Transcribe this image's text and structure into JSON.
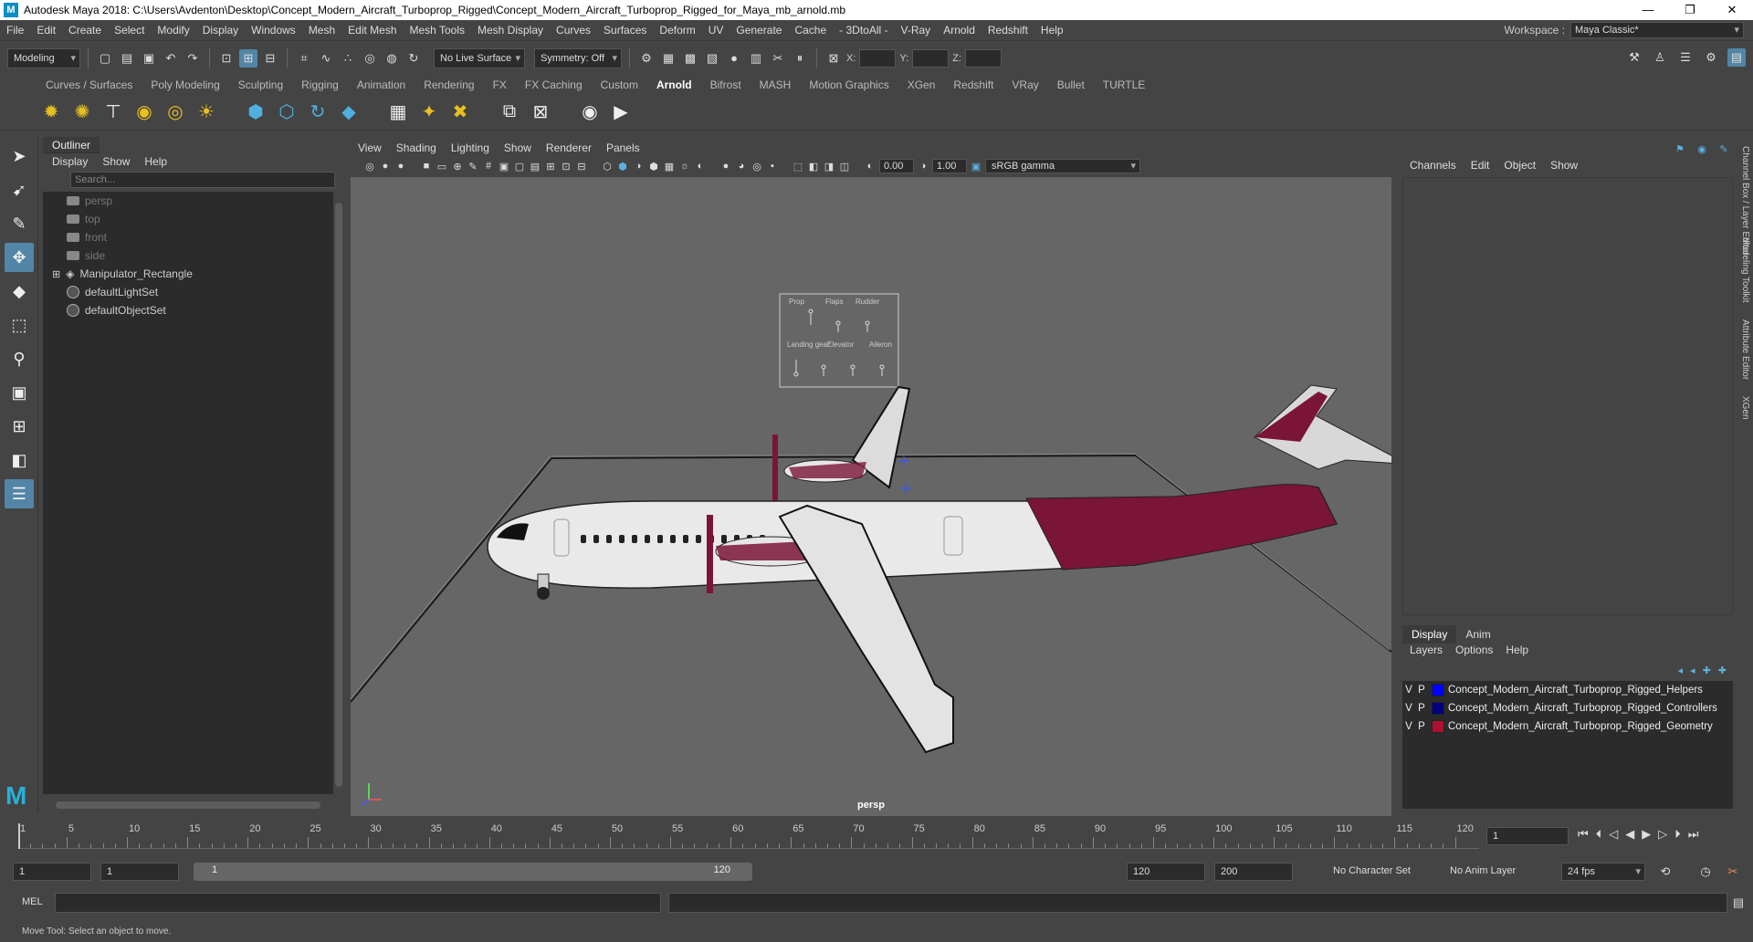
{
  "title": "Autodesk Maya 2018: C:\\Users\\Avdenton\\Desktop\\Concept_Modern_Aircraft_Turboprop_Rigged\\Concept_Modern_Aircraft_Turboprop_Rigged_for_Maya_mb_arnold.mb",
  "window_buttons": {
    "minimize": "—",
    "maximize": "❐",
    "close": "✕"
  },
  "menus": [
    "File",
    "Edit",
    "Create",
    "Select",
    "Modify",
    "Display",
    "Windows",
    "Mesh",
    "Edit Mesh",
    "Mesh Tools",
    "Mesh Display",
    "Curves",
    "Surfaces",
    "Deform",
    "UV",
    "Generate",
    "Cache",
    "- 3DtoAll -",
    "V-Ray",
    "Arnold",
    "Redshift",
    "Help"
  ],
  "workspace": {
    "label": "Workspace :",
    "value": "Maya Classic*"
  },
  "status_line": {
    "mode": "Modeling",
    "live_surface": "No Live Surface",
    "symmetry": "Symmetry: Off",
    "x_label": "X:",
    "y_label": "Y:",
    "z_label": "Z:"
  },
  "shelf_tabs": [
    "Curves / Surfaces",
    "Poly Modeling",
    "Sculpting",
    "Rigging",
    "Animation",
    "Rendering",
    "FX",
    "FX Caching",
    "Custom",
    "Arnold",
    "Bifrost",
    "MASH",
    "Motion Graphics",
    "XGen",
    "Redshift",
    "VRay",
    "Bullet",
    "TURTLE"
  ],
  "shelf_active": "Arnold",
  "outliner": {
    "title": "Outliner",
    "menus": [
      "Display",
      "Show",
      "Help"
    ],
    "search_placeholder": "Search...",
    "items": [
      {
        "label": "persp",
        "type": "camera",
        "dim": true
      },
      {
        "label": "top",
        "type": "camera",
        "dim": true
      },
      {
        "label": "front",
        "type": "camera",
        "dim": true
      },
      {
        "label": "side",
        "type": "camera",
        "dim": true
      },
      {
        "label": "Manipulator_Rectangle",
        "type": "group",
        "dim": false
      },
      {
        "label": "defaultLightSet",
        "type": "set",
        "dim": false
      },
      {
        "label": "defaultObjectSet",
        "type": "set",
        "dim": false
      }
    ]
  },
  "viewport": {
    "menus": [
      "View",
      "Shading",
      "Lighting",
      "Show",
      "Renderer",
      "Panels"
    ],
    "exposure": "0.00",
    "gamma": "1.00",
    "color_space": "sRGB gamma",
    "camera_label": "persp",
    "hud_labels": {
      "row1": [
        "Prop",
        "Flaps",
        "Rudder"
      ],
      "row2": [
        "Landing gear",
        "Elevator",
        "Aileron"
      ]
    },
    "fuselage_color": "#e9e9e9",
    "livery_color": "#7a1538"
  },
  "channel_box": {
    "menus": [
      "Channels",
      "Edit",
      "Object",
      "Show"
    ],
    "layer_tabs": [
      "Display",
      "Anim"
    ],
    "layer_menus": [
      "Layers",
      "Options",
      "Help"
    ],
    "layers": [
      {
        "v": "V",
        "p": "P",
        "name": "Concept_Modern_Aircraft_Turboprop_Rigged_Helpers",
        "color": "#0000ff"
      },
      {
        "v": "V",
        "p": "P",
        "name": "Concept_Modern_Aircraft_Turboprop_Rigged_Controllers",
        "color": "#000080"
      },
      {
        "v": "V",
        "p": "P",
        "name": "Concept_Modern_Aircraft_Turboprop_Rigged_Geometry",
        "color": "#b01030"
      }
    ]
  },
  "side_tabs": [
    "Channel Box / Layer Editor",
    "Modeling Toolkit",
    "Attribute Editor",
    "XGen"
  ],
  "timeline": {
    "labels": [
      "1",
      "5",
      "10",
      "15",
      "20",
      "25",
      "30",
      "35",
      "40",
      "45",
      "50",
      "55",
      "60",
      "65",
      "70",
      "75",
      "80",
      "85",
      "90",
      "95",
      "100",
      "105",
      "110",
      "115",
      "120"
    ],
    "current_frame": "1"
  },
  "range": {
    "start": "1",
    "anim_start": "1",
    "slider_start": "1",
    "slider_end": "120",
    "end": "120",
    "anim_end": "200",
    "character_set": "No Character Set",
    "anim_layer": "No Anim Layer",
    "fps": "24 fps"
  },
  "cmd": {
    "mel": "MEL"
  },
  "help_line": "Move Tool: Select an object to move."
}
